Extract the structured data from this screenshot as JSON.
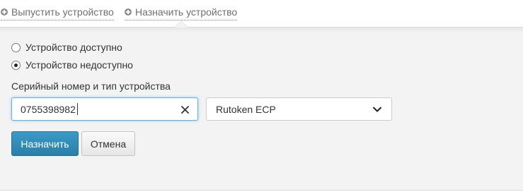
{
  "top_links": {
    "release_label": "Выпустить устройство",
    "assign_label": "Назначить устройство"
  },
  "availability": {
    "options": [
      {
        "label": "Устройство доступно",
        "checked": false
      },
      {
        "label": "Устройство недоступно",
        "checked": true
      }
    ]
  },
  "serial": {
    "label": "Серийный номер и тип устройства",
    "value": "0755398982"
  },
  "device_type": {
    "selected": "Rutoken ECP"
  },
  "actions": {
    "assign_button": "Назначить",
    "cancel_button": "Отмена"
  },
  "colors": {
    "primary_button": "#2f8ab6",
    "focus_border": "#66afe9",
    "panel_background": "#f3f3f3"
  }
}
